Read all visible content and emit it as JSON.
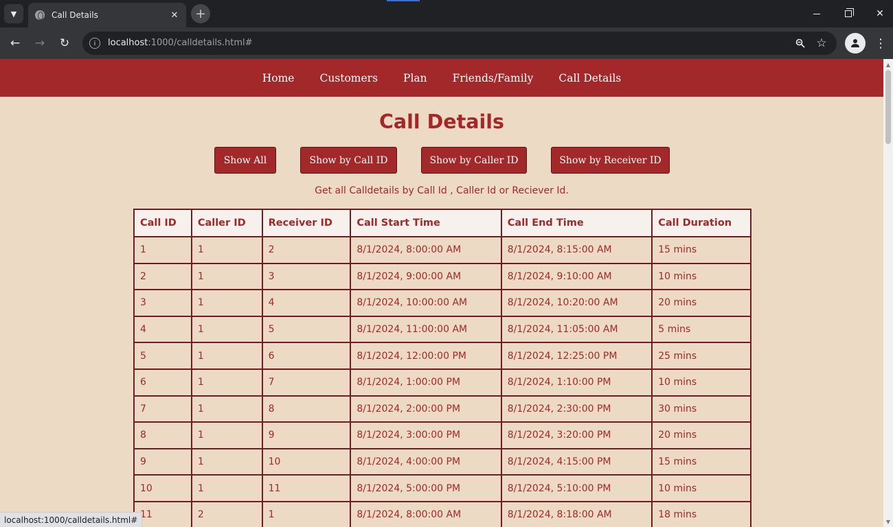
{
  "browser": {
    "tab_title": "Call Details",
    "url_host": "localhost",
    "url_path": ":1000/calldetails.html#",
    "status_url": "localhost:1000/calldetails.html#"
  },
  "nav": {
    "links": [
      "Home",
      "Customers",
      "Plan",
      "Friends/Family",
      "Call Details"
    ]
  },
  "page": {
    "title": "Call Details",
    "buttons": [
      "Show All",
      "Show by Call ID",
      "Show by Caller ID",
      "Show by Receiver ID"
    ],
    "hint": "Get all Calldetails by Call Id , Caller Id or Reciever Id."
  },
  "table": {
    "headers": [
      "Call ID",
      "Caller ID",
      "Receiver ID",
      "Call Start Time",
      "Call End Time",
      "Call Duration"
    ],
    "rows": [
      [
        "1",
        "1",
        "2",
        "8/1/2024, 8:00:00 AM",
        "8/1/2024, 8:15:00 AM",
        "15 mins"
      ],
      [
        "2",
        "1",
        "3",
        "8/1/2024, 9:00:00 AM",
        "8/1/2024, 9:10:00 AM",
        "10 mins"
      ],
      [
        "3",
        "1",
        "4",
        "8/1/2024, 10:00:00 AM",
        "8/1/2024, 10:20:00 AM",
        "20 mins"
      ],
      [
        "4",
        "1",
        "5",
        "8/1/2024, 11:00:00 AM",
        "8/1/2024, 11:05:00 AM",
        "5 mins"
      ],
      [
        "5",
        "1",
        "6",
        "8/1/2024, 12:00:00 PM",
        "8/1/2024, 12:25:00 PM",
        "25 mins"
      ],
      [
        "6",
        "1",
        "7",
        "8/1/2024, 1:00:00 PM",
        "8/1/2024, 1:10:00 PM",
        "10 mins"
      ],
      [
        "7",
        "1",
        "8",
        "8/1/2024, 2:00:00 PM",
        "8/1/2024, 2:30:00 PM",
        "30 mins"
      ],
      [
        "8",
        "1",
        "9",
        "8/1/2024, 3:00:00 PM",
        "8/1/2024, 3:20:00 PM",
        "20 mins"
      ],
      [
        "9",
        "1",
        "10",
        "8/1/2024, 4:00:00 PM",
        "8/1/2024, 4:15:00 PM",
        "15 mins"
      ],
      [
        "10",
        "1",
        "11",
        "8/1/2024, 5:00:00 PM",
        "8/1/2024, 5:10:00 PM",
        "10 mins"
      ],
      [
        "11",
        "2",
        "1",
        "8/1/2024, 8:00:00 AM",
        "8/1/2024, 8:18:00 AM",
        "18 mins"
      ]
    ]
  },
  "colors": {
    "brand_red": "#a3282a",
    "page_bg": "#ecdac5",
    "table_border": "#6e1e22"
  },
  "icons": [
    "tab-list-icon",
    "globe-icon",
    "close-icon",
    "plus-icon",
    "back-arrow-icon",
    "forward-arrow-icon",
    "reload-icon",
    "site-info-icon",
    "zoom-icon",
    "star-icon",
    "profile-icon",
    "more-vert-icon"
  ]
}
